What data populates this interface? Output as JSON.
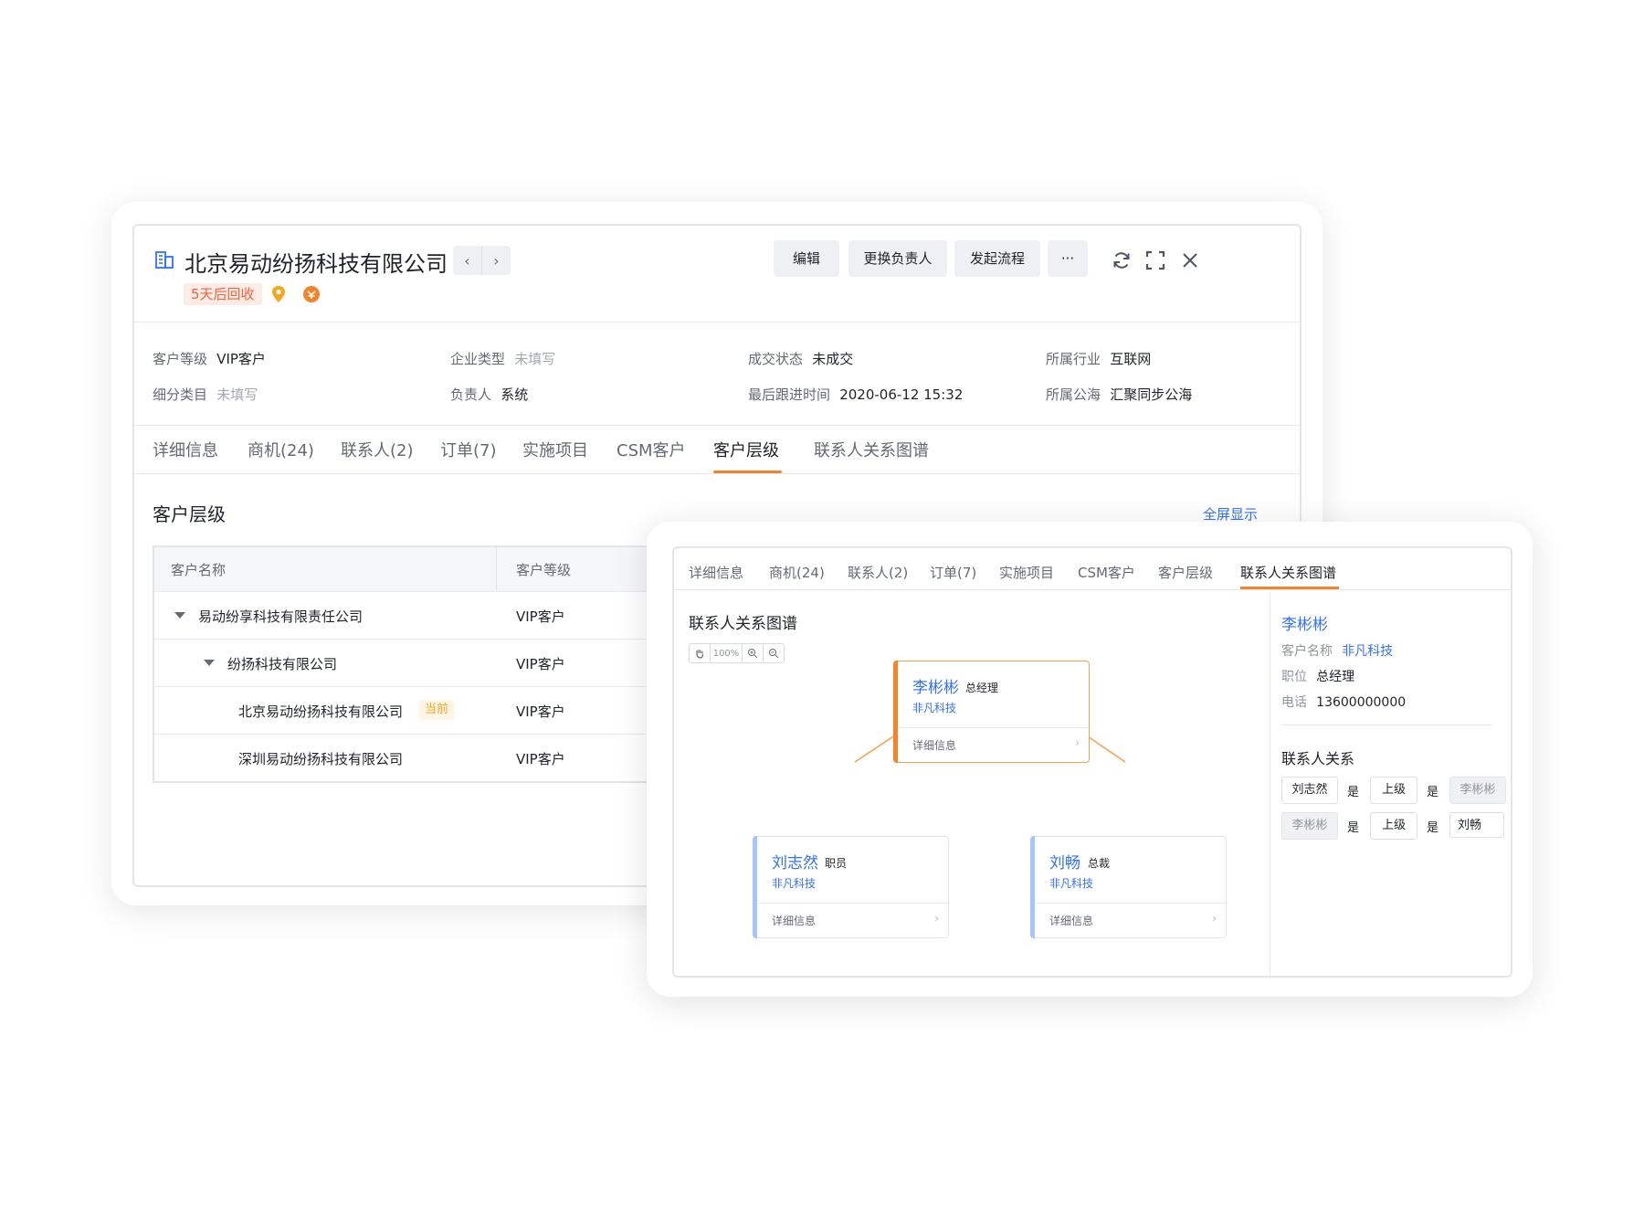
{
  "detail": {
    "title": "北京易动纷扬科技有限公司",
    "recycle_tag": "5天后回收",
    "icons": [
      "building-icon",
      "chevron-left-icon",
      "chevron-right-icon",
      "location-pin-icon",
      "coin-icon",
      "refresh-icon",
      "fullscreen-icon",
      "close-icon"
    ],
    "buttons": {
      "edit": "编辑",
      "change_owner": "更换负责人",
      "start_flow": "发起流程",
      "more": "···"
    },
    "info": {
      "customer_level": {
        "label": "客户等级",
        "value": "VIP客户"
      },
      "company_type": {
        "label": "企业类型",
        "value": "未填写"
      },
      "deal_status": {
        "label": "成交状态",
        "value": "未成交"
      },
      "industry": {
        "label": "所属行业",
        "value": "互联网"
      },
      "sub_category": {
        "label": "细分类目",
        "value": "未填写"
      },
      "owner": {
        "label": "负责人",
        "value": "系统"
      },
      "last_follow": {
        "label": "最后跟进时间",
        "value": "2020-06-12 15:32"
      },
      "public_pool": {
        "label": "所属公海",
        "value": "汇聚同步公海"
      }
    },
    "tabs": [
      "详细信息",
      "商机(24)",
      "联系人(2)",
      "订单(7)",
      "实施项目",
      "CSM客户",
      "客户层级",
      "联系人关系图谱"
    ],
    "active_tab": "客户层级",
    "section_title": "客户层级",
    "fullscreen_link": "全屏显示",
    "table": {
      "columns": [
        "客户名称",
        "客户等级"
      ],
      "rows": [
        {
          "name": "易动纷享科技有限责任公司",
          "level": "VIP客户"
        },
        {
          "name": "纷扬科技有限公司",
          "level": "VIP客户"
        },
        {
          "name": "北京易动纷扬科技有限公司",
          "level": "VIP客户",
          "tag": "当前"
        },
        {
          "name": "深圳易动纷扬科技有限公司",
          "level": "VIP客户"
        }
      ]
    }
  },
  "graph_panel": {
    "tabs": [
      "详细信息",
      "商机(24)",
      "联系人(2)",
      "订单(7)",
      "实施项目",
      "CSM客户",
      "客户层级",
      "联系人关系图谱"
    ],
    "active_tab": "联系人关系图谱",
    "title": "联系人关系图谱",
    "zoom": "100%",
    "nodes": [
      {
        "name": "李彬彬",
        "role": "总经理",
        "company": "非凡科技",
        "detail": "详细信息",
        "accent": "#f5832a"
      },
      {
        "name": "刘志然",
        "role": "职员",
        "company": "非凡科技",
        "detail": "详细信息",
        "accent": "#a8c4ff"
      },
      {
        "name": "刘畅",
        "role": "总裁",
        "company": "非凡科技",
        "detail": "详细信息",
        "accent": "#a8c4ff"
      }
    ],
    "edge_label": "上级",
    "side": {
      "name": "李彬彬",
      "customer_label": "客户名称",
      "customer": "非凡科技",
      "position_label": "职位",
      "position": "总经理",
      "phone_label": "电话",
      "phone": "13600000000",
      "relations_title": "联系人关系",
      "relations": [
        {
          "a": "刘志然",
          "is1": "是",
          "rel": "上级",
          "is2": "是",
          "b": "李彬彬"
        },
        {
          "a": "李彬彬",
          "is1": "是",
          "rel": "上级",
          "is2": "是",
          "b": "刘畅"
        }
      ]
    }
  }
}
